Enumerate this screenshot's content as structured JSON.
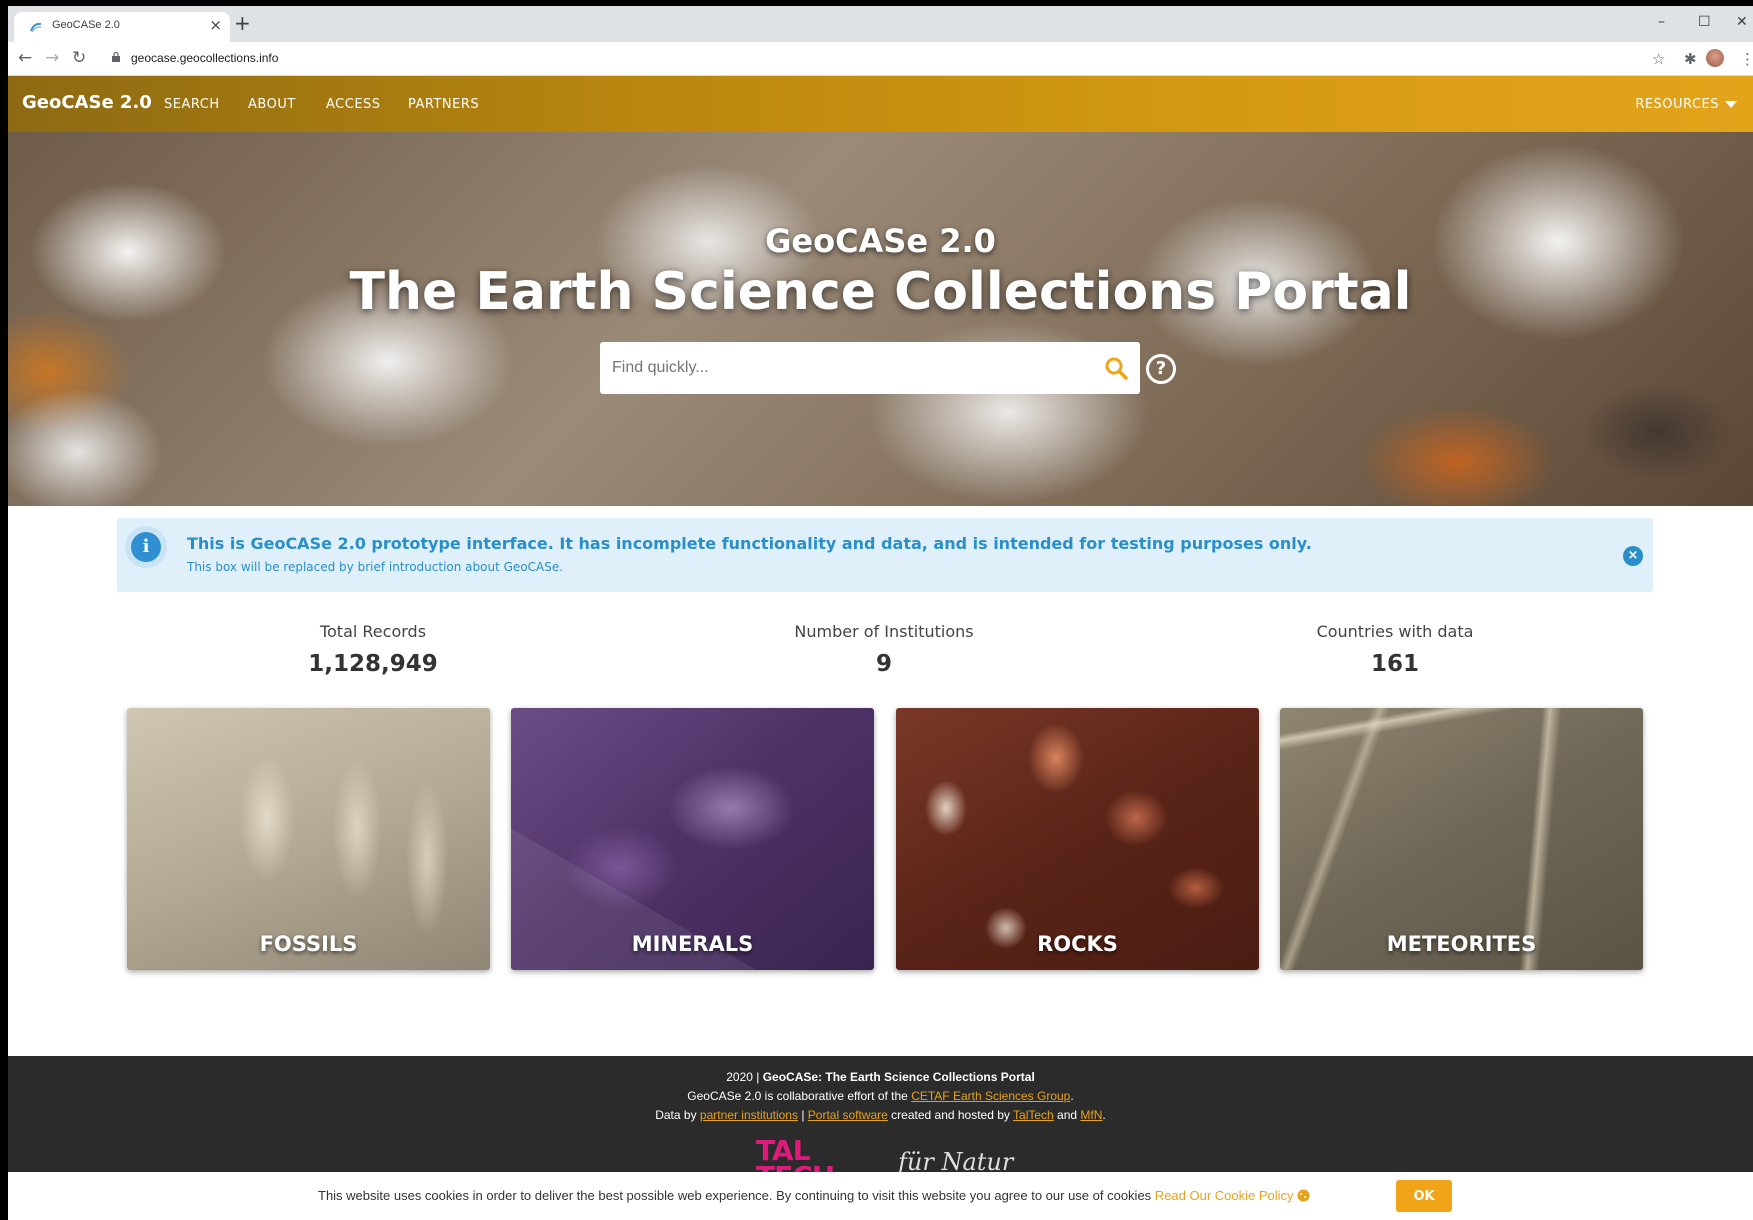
{
  "browser": {
    "tab_title": "GeoCASe 2.0",
    "tab_close": "×",
    "new_tab": "+",
    "url": "geocase.geocollections.info",
    "win_min": "–",
    "win_max": "☐",
    "win_close": "✕",
    "back": "←",
    "forward": "→",
    "reload": "↻",
    "star": "☆",
    "extensions": "✱",
    "menu": "⋮"
  },
  "navbar": {
    "brand": "GeoCASe 2.0",
    "links": [
      "SEARCH",
      "ABOUT",
      "ACCESS",
      "PARTNERS"
    ],
    "resources": "RESOURCES"
  },
  "hero": {
    "subtitle": "GeoCASe 2.0",
    "title": "The Earth Science Collections Portal",
    "search_placeholder": "Find quickly...",
    "help": "?"
  },
  "alert": {
    "icon": "i",
    "headline": "This is GeoCASe 2.0 prototype interface. It has incomplete functionality and data, and is intended for testing purposes only.",
    "body": "This box will be replaced by brief introduction about GeoCASe.",
    "close": "×"
  },
  "stats": [
    {
      "label": "Total Records",
      "value": "1,128,949"
    },
    {
      "label": "Number of Institutions",
      "value": "9"
    },
    {
      "label": "Countries with data",
      "value": "161"
    }
  ],
  "cards": [
    "FOSSILS",
    "MINERALS",
    "ROCKS",
    "METEORITES"
  ],
  "footer": {
    "line1_prefix": "2020 | ",
    "line1_bold": "GeoCASe: The Earth Science Collections Portal",
    "line2_prefix": "GeoCASe 2.0 is collaborative effort of the ",
    "line2_link": "CETAF Earth Sciences Group",
    "line2_suffix": ".",
    "line3_prefix": "Data by ",
    "line3_link1": "partner institutions",
    "line3_sep": " | ",
    "line3_link2": "Portal software",
    "line3_mid": " created and hosted by ",
    "line3_link3": "TalTech",
    "line3_and": " and ",
    "line3_link4": "MfN",
    "line3_suffix": ".",
    "logo_taltech": "TAL\nTECH",
    "logo_mfn": "fürNatur"
  },
  "cookie": {
    "text": "This website uses cookies in order to deliver the best possible web experience. By continuing to visit this website you agree to our use of cookies ",
    "link": "Read Our Cookie Policy",
    "button": "OK"
  },
  "colors": {
    "navbar_accent": "#d69a12",
    "alert_bg": "#dff0fa",
    "alert_text": "#2a8fc9",
    "footer_bg": "#2b2b2b",
    "cookie_button": "#f0a518"
  }
}
